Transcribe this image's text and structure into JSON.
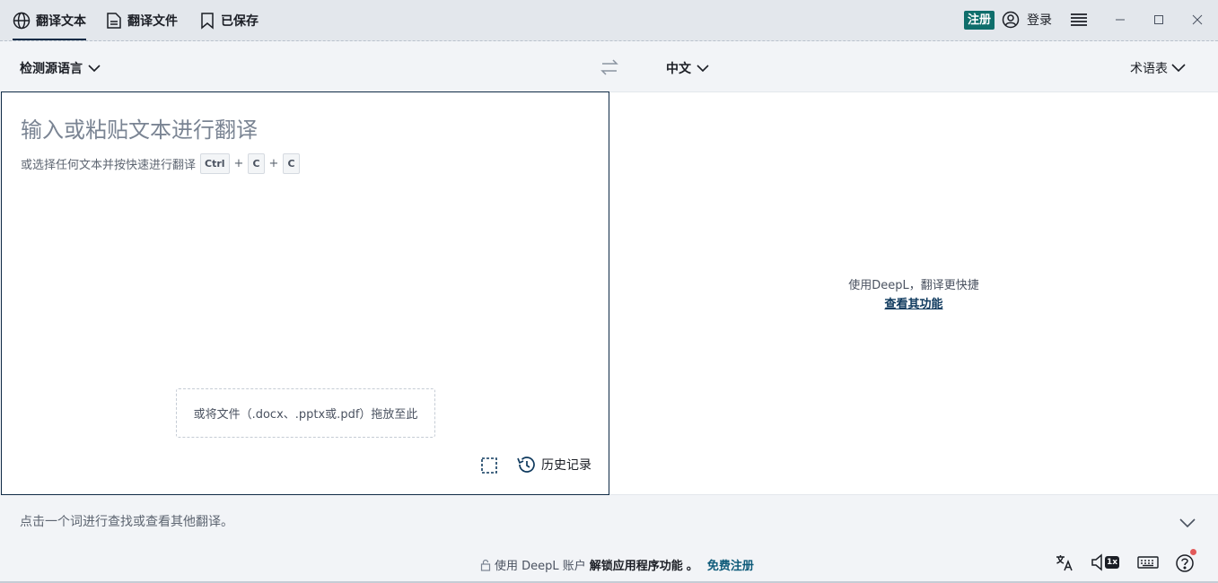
{
  "tabs": [
    {
      "label": "翻译文本",
      "icon": "globe-icon",
      "active": true
    },
    {
      "label": "翻译文件",
      "icon": "document-icon",
      "active": false
    },
    {
      "label": "已保存",
      "icon": "bookmark-icon",
      "active": false
    }
  ],
  "header": {
    "signup_label": "注册",
    "login_label": "登录"
  },
  "lang": {
    "source": "检测源语言",
    "target": "中文",
    "glossary": "术语表"
  },
  "source": {
    "placeholder": "输入或粘贴文本进行翻译",
    "hint": "或选择任何文本并按快速进行翻译",
    "keys": [
      "Ctrl",
      "C",
      "C"
    ],
    "plus": "+",
    "dropzone": "或将文件（.docx、.pptx或.pdf）拖放至此",
    "history_label": "历史记录"
  },
  "target": {
    "promo_text": "使用DeepL，翻译更快捷",
    "promo_link": "查看其功能"
  },
  "dictionary": {
    "hint": "点击一个词进行查找或查看其他翻译。"
  },
  "footer": {
    "msg_prefix": "使用 DeepL 账户",
    "msg_bold": "解锁应用程序功能",
    "msg_suffix": "。",
    "link": "免费注册",
    "speed_badge": "1x"
  },
  "colors": {
    "accent": "#0f2b46",
    "signup_bg": "#0f6e6b",
    "notify_dot": "#e25a5a"
  }
}
